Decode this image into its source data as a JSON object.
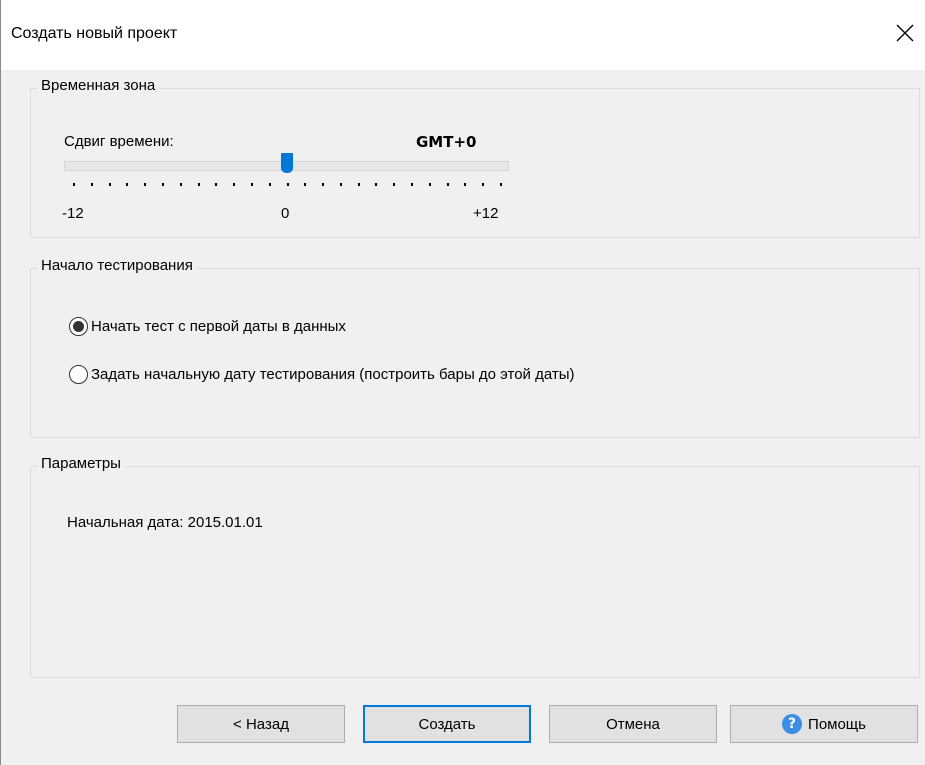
{
  "window": {
    "title": "Создать новый проект"
  },
  "timezone": {
    "legend": "Временная зона",
    "label": "Сдвиг времени:",
    "value": "GMT+0",
    "slider": {
      "min": -12,
      "max": 12,
      "current": 0
    },
    "tick_labels": {
      "min": "-12",
      "mid": "0",
      "max": "+12"
    }
  },
  "start": {
    "legend": "Начало тестирования",
    "options": [
      {
        "label": "Начать тест с первой даты в данных",
        "selected": true
      },
      {
        "label": "Задать начальную дату тестирования (построить бары до этой даты)",
        "selected": false
      }
    ]
  },
  "params": {
    "legend": "Параметры",
    "start_date": "Начальная дата: 2015.01.01"
  },
  "buttons": {
    "back": "< Назад",
    "create": "Создать",
    "cancel": "Отмена",
    "help": "Помощь"
  },
  "colors": {
    "accent": "#0078d7",
    "help_icon": "#3a8ee6"
  }
}
